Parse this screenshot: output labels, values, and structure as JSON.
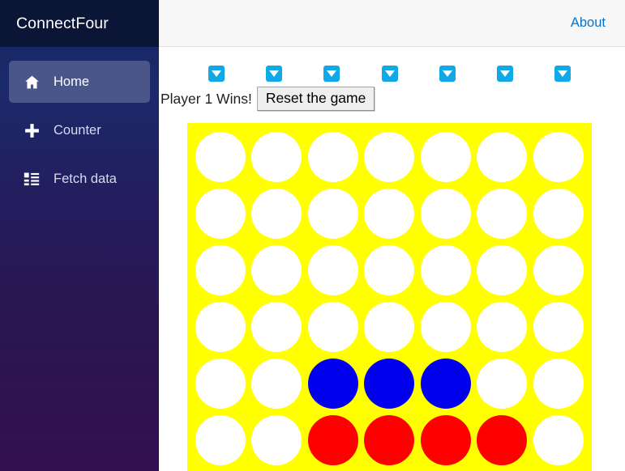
{
  "app": {
    "brand": "ConnectFour"
  },
  "header": {
    "about_label": "About"
  },
  "sidebar": {
    "items": [
      {
        "label": "Home",
        "icon": "home-icon",
        "active": true
      },
      {
        "label": "Counter",
        "icon": "plus-icon",
        "active": false
      },
      {
        "label": "Fetch data",
        "icon": "list-icon",
        "active": false
      }
    ]
  },
  "game": {
    "status_text": "Player 1 Wins!",
    "reset_label": "Reset the game",
    "drop_icon": "triangle-down-icon",
    "columns": 7,
    "rows": 6,
    "colors": {
      "board": "#ffff00",
      "empty": "#ffffff",
      "player1": "#ff0000",
      "player2": "#0000ee",
      "drop_button": "#11a8e8",
      "accent_link": "#0a72c4"
    },
    "board": [
      [
        "empty",
        "empty",
        "empty",
        "empty",
        "empty",
        "empty",
        "empty"
      ],
      [
        "empty",
        "empty",
        "empty",
        "empty",
        "empty",
        "empty",
        "empty"
      ],
      [
        "empty",
        "empty",
        "empty",
        "empty",
        "empty",
        "empty",
        "empty"
      ],
      [
        "empty",
        "empty",
        "empty",
        "empty",
        "empty",
        "empty",
        "empty"
      ],
      [
        "empty",
        "empty",
        "blue",
        "blue",
        "blue",
        "empty",
        "empty"
      ],
      [
        "empty",
        "empty",
        "red",
        "red",
        "red",
        "red",
        "empty"
      ]
    ]
  }
}
